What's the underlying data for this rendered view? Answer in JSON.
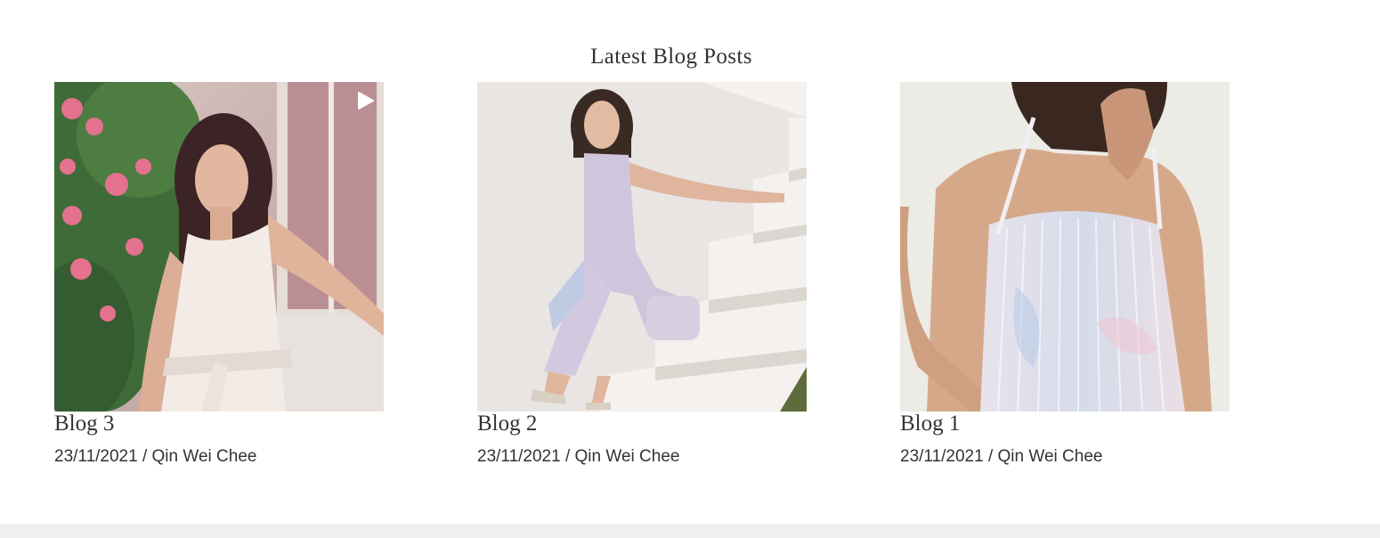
{
  "section": {
    "title": "Latest Blog Posts"
  },
  "posts": [
    {
      "title": "Blog 3",
      "date": "23/11/2021",
      "separator": " / ",
      "author": "Qin Wei Chee",
      "image_icon": "play-icon"
    },
    {
      "title": "Blog 2",
      "date": "23/11/2021",
      "separator": " / ",
      "author": "Qin Wei Chee"
    },
    {
      "title": "Blog 1",
      "date": "23/11/2021",
      "separator": " / ",
      "author": "Qin Wei Chee"
    }
  ],
  "colors": {
    "text": "#333333",
    "background": "#ffffff",
    "footer": "#f0f0f0"
  }
}
